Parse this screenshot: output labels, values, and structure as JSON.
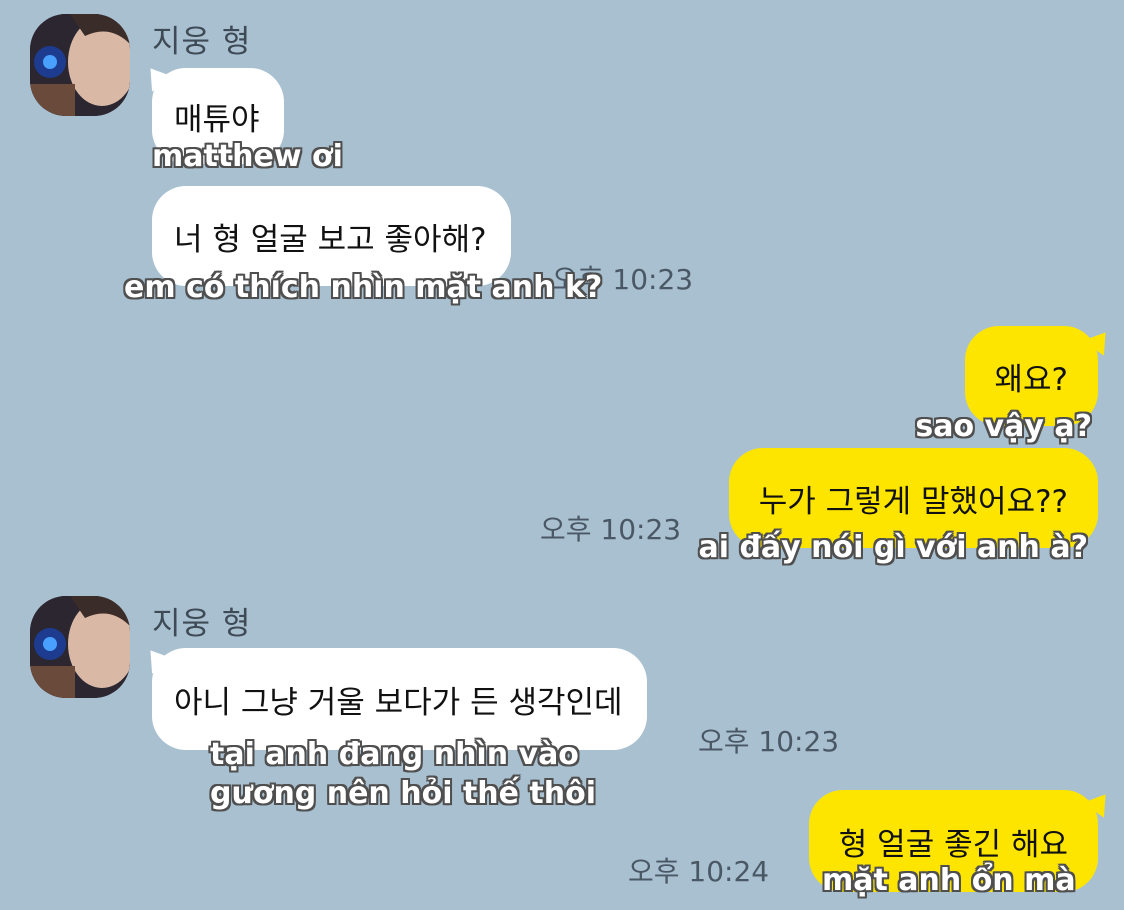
{
  "chat": {
    "sender_name": "지웅 형",
    "messages": [
      {
        "text": "매튜야",
        "subtitle": "matthew ơi"
      },
      {
        "text": "너 형 얼굴 보고 좋아해?",
        "subtitle": "em có thích nhìn mặt anh k?",
        "time": "오후 10:23"
      },
      {
        "text": "왜요?",
        "subtitle": "sao vậy ạ?"
      },
      {
        "text": "누가 그렇게 말했어요??",
        "subtitle": "ai đấy nói gì với anh à?",
        "time": "오후 10:23"
      },
      {
        "text": "아니 그냥 거울 보다가 든 생각인데",
        "subtitle_line1": "tại anh đang nhìn vào",
        "subtitle_line2": "gương nên hỏi thế thôi",
        "time": "오후 10:23"
      },
      {
        "text": "형 얼굴 좋긴 해요",
        "subtitle": "mặt anh ổn mà",
        "time": "오후 10:24"
      }
    ]
  },
  "colors": {
    "background": "#a9c0d1",
    "incoming_bubble": "#ffffff",
    "outgoing_bubble": "#fde500"
  }
}
